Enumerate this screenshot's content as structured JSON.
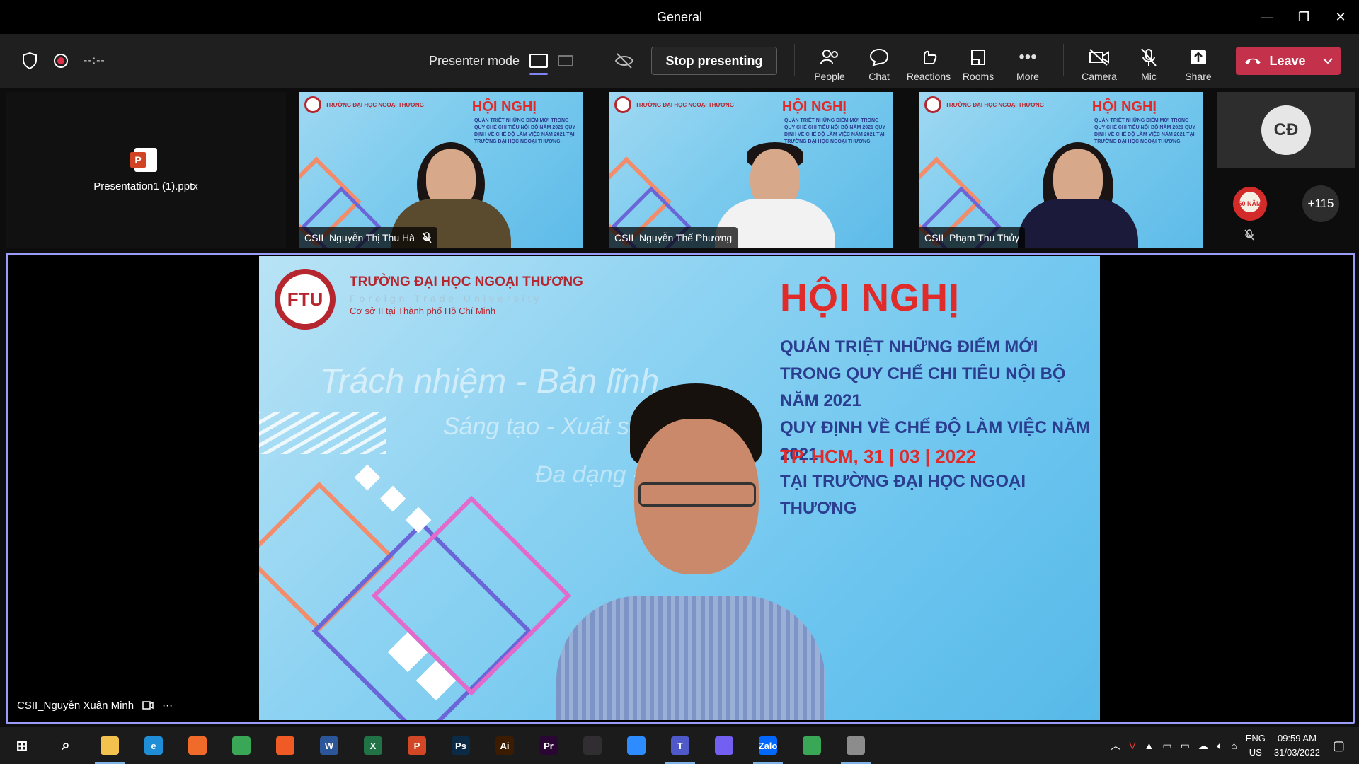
{
  "window": {
    "title": "General",
    "minimize": "—",
    "restore": "❐",
    "close": "✕"
  },
  "toolbar": {
    "timer": "--:--",
    "presenter_mode_label": "Presenter mode",
    "stop_presenting_label": "Stop presenting",
    "people_label": "People",
    "chat_label": "Chat",
    "reactions_label": "Reactions",
    "rooms_label": "Rooms",
    "more_label": "More",
    "camera_label": "Camera",
    "mic_label": "Mic",
    "share_label": "Share",
    "leave_label": "Leave",
    "accent_color": "#c4314b",
    "highlight_color": "#7f85f5"
  },
  "shared_file": {
    "name": "Presentation1 (1).pptx",
    "icon": "powerpoint-icon"
  },
  "tiles": [
    {
      "name": "CSII_Nguyễn Thị Thu Hà",
      "muted": true
    },
    {
      "name": "CSII_Nguyễn Thế Phương",
      "muted": false
    },
    {
      "name": "CSII_Phạm Thu Thủy",
      "muted": false
    }
  ],
  "tile_slide": {
    "hoi_nghi": "HỘI NGHỊ",
    "school": "TRƯỜNG ĐẠI HỌC NGOẠI THƯƠNG",
    "slogan": "Trách nhiệm - Bản lĩnh",
    "subtext": "QUÁN TRIỆT NHỮNG ĐIỂM MỚI TRONG QUY CHẾ CHI TIÊU NỘI BỘ NĂM 2021 QUY ĐỊNH VỀ CHẾ ĐỘ LÀM VIỆC NĂM 2021 TẠI TRƯỜNG ĐẠI HỌC NGOẠI THƯƠNG",
    "date": "TP. HCM, 31 | 03 | 2022"
  },
  "avatar": {
    "initials": "CĐ",
    "small_badge": "60 NĂM"
  },
  "overflow_count": "+115",
  "slide": {
    "logo_text": "FTU",
    "school": "TRƯỜNG ĐẠI HỌC NGOẠI THƯƠNG",
    "school_en": "Foreign Trade University",
    "campus": "Cơ sở II tại Thành phố Hồ Chí Minh",
    "title": "HỘI NGHỊ",
    "lines": [
      "QUÁN TRIỆT NHỮNG ĐIỂM MỚI",
      "TRONG QUY CHẾ CHI TIÊU NỘI BỘ NĂM 2021",
      "QUY ĐỊNH VỀ CHẾ ĐỘ LÀM VIỆC NĂM 2021",
      "TẠI TRƯỜNG ĐẠI HỌC NGOẠI THƯƠNG"
    ],
    "date": "TP. HCM, 31 | 03 | 2022",
    "slogan1": "Trách nhiệm - Bản lĩnh",
    "slogan2": "Sáng tạo - Xuất sắc",
    "slogan3": "Đa dạng -"
  },
  "main_speaker": {
    "name": "CSII_Nguyễn Xuân Minh",
    "more": "⋯"
  },
  "taskbar": {
    "apps": [
      {
        "name": "start",
        "label": "⊞",
        "color": "#1b1b1b"
      },
      {
        "name": "search",
        "label": "⌕",
        "color": "#1b1b1b"
      },
      {
        "name": "file-explorer",
        "label": "",
        "color": "#f2c14e"
      },
      {
        "name": "edge",
        "label": "e",
        "color": "#1f8ed6"
      },
      {
        "name": "firefox",
        "label": "",
        "color": "#f06a2a"
      },
      {
        "name": "chrome",
        "label": "",
        "color": "#3aa757"
      },
      {
        "name": "brave",
        "label": "",
        "color": "#f05a24"
      },
      {
        "name": "word",
        "label": "W",
        "color": "#2b579a"
      },
      {
        "name": "excel",
        "label": "X",
        "color": "#217346"
      },
      {
        "name": "powerpoint",
        "label": "P",
        "color": "#d24726"
      },
      {
        "name": "photoshop",
        "label": "Ps",
        "color": "#0b2a45"
      },
      {
        "name": "illustrator",
        "label": "Ai",
        "color": "#3b1c00"
      },
      {
        "name": "premiere",
        "label": "Pr",
        "color": "#2a0634"
      },
      {
        "name": "obs",
        "label": "",
        "color": "#302e31"
      },
      {
        "name": "zoom",
        "label": "",
        "color": "#2d8cff"
      },
      {
        "name": "teams",
        "label": "T",
        "color": "#5059c9"
      },
      {
        "name": "viber",
        "label": "",
        "color": "#7360f2"
      },
      {
        "name": "zalo",
        "label": "Zalo",
        "color": "#0068ff"
      },
      {
        "name": "chrome-2",
        "label": "",
        "color": "#3aa757"
      },
      {
        "name": "paint",
        "label": "",
        "color": "#8c8c8c"
      }
    ],
    "lang_top": "ENG",
    "lang_bottom": "US",
    "time": "09:59 AM",
    "date": "31/03/2022"
  }
}
